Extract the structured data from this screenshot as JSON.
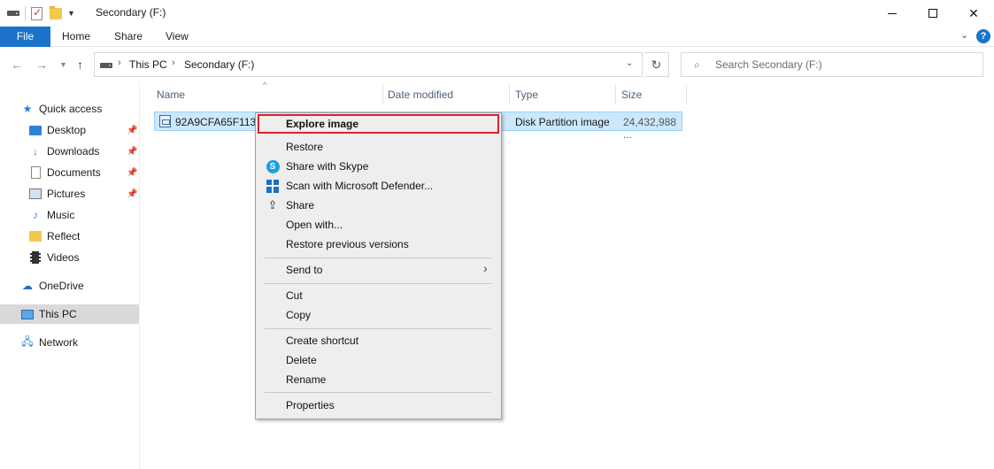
{
  "window": {
    "title": "Secondary (F:)"
  },
  "ribbon": {
    "file": "File",
    "tabs": [
      "Home",
      "Share",
      "View"
    ],
    "help": "?"
  },
  "address": {
    "crumbs": [
      "This PC",
      "Secondary (F:)"
    ]
  },
  "search": {
    "placeholder": "Search Secondary (F:)"
  },
  "sidebar": {
    "quick_access": "Quick access",
    "items": [
      "Desktop",
      "Downloads",
      "Documents",
      "Pictures",
      "Music",
      "Reflect",
      "Videos"
    ],
    "onedrive": "OneDrive",
    "this_pc": "This PC",
    "network": "Network"
  },
  "columns": {
    "name": "Name",
    "date": "Date modified",
    "type": "Type",
    "size": "Size"
  },
  "file": {
    "name": "92A9CFA65F113C",
    "type": "Disk Partition image",
    "size": "24,432,988 ..."
  },
  "context_menu": {
    "explore": "Explore image",
    "restore": "Restore",
    "skype": "Share with Skype",
    "defender": "Scan with Microsoft Defender...",
    "share": "Share",
    "open_with": "Open with...",
    "restore_prev": "Restore previous versions",
    "send_to": "Send to",
    "cut": "Cut",
    "copy": "Copy",
    "create_shortcut": "Create shortcut",
    "delete": "Delete",
    "rename": "Rename",
    "properties": "Properties"
  },
  "colors": {
    "accent": "#1a73c8",
    "highlight_border": "#d9242b",
    "selection": "#cce8ff"
  }
}
